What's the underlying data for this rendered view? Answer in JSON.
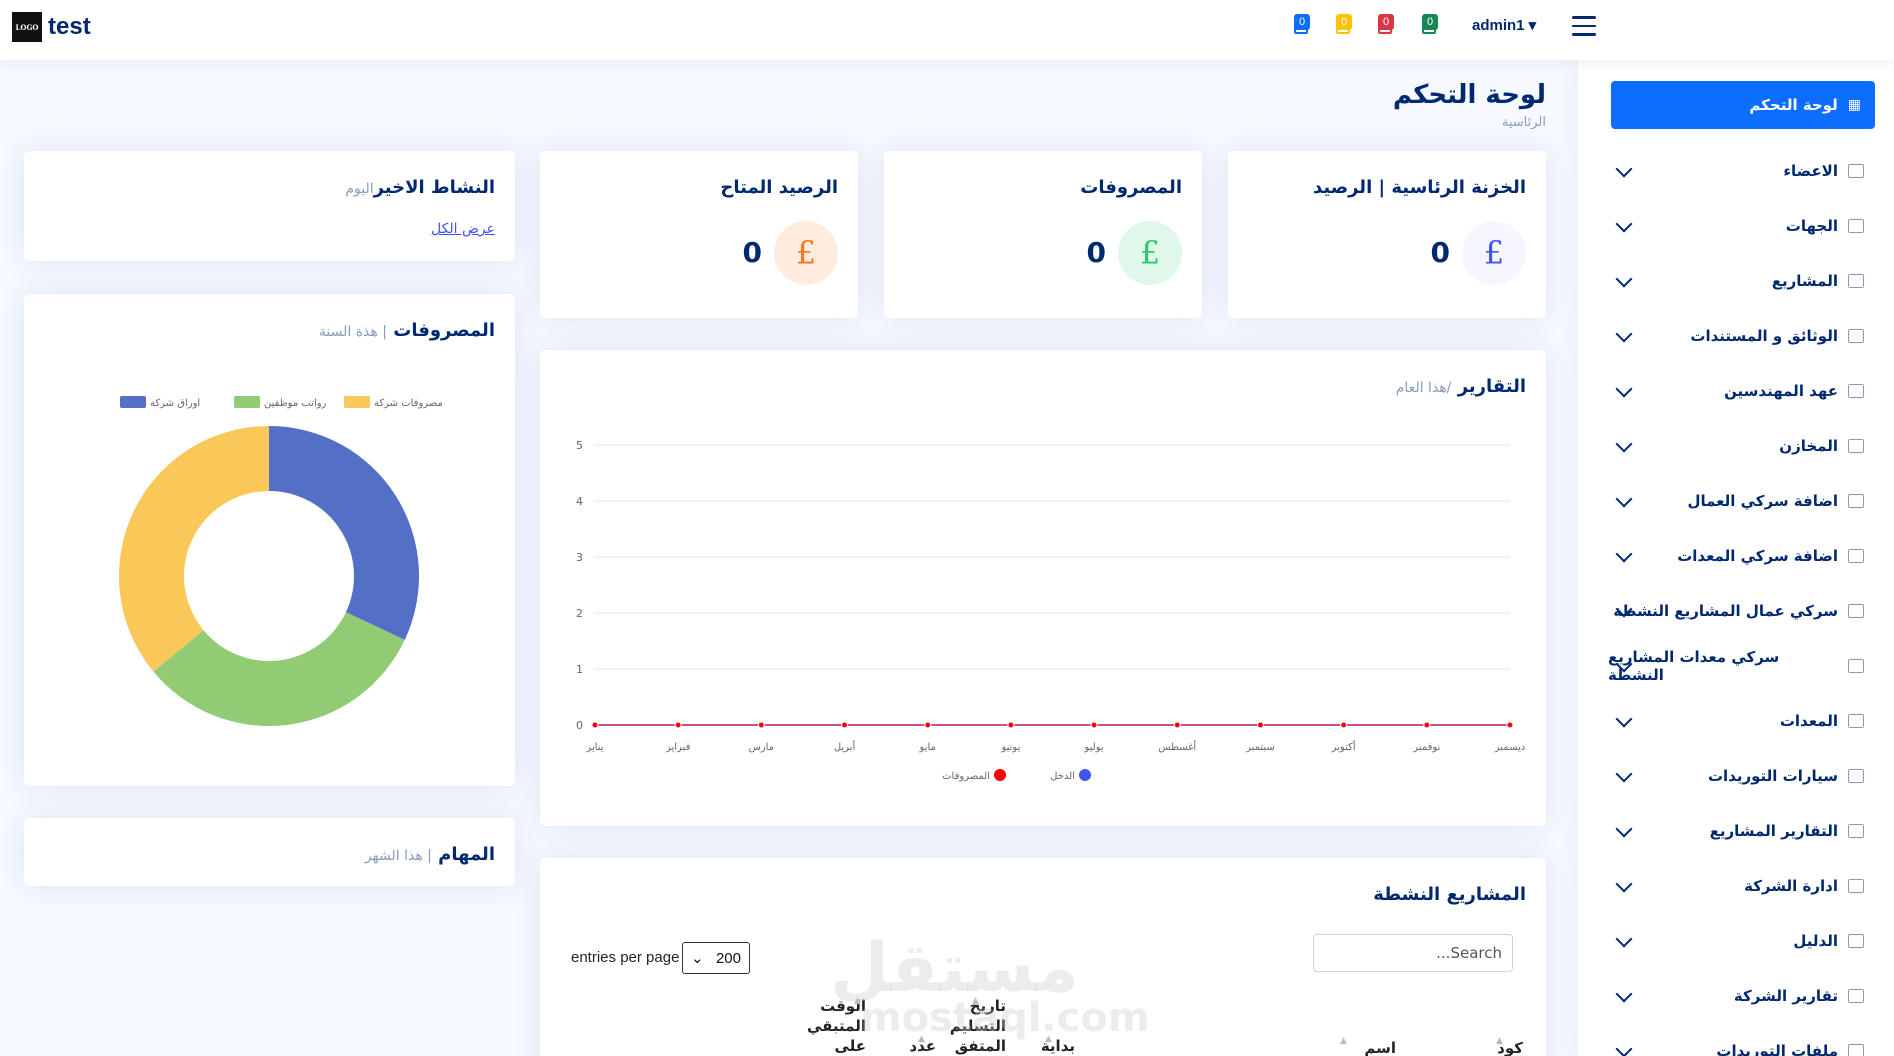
{
  "app": {
    "logo_text": "LOGO",
    "name": "test"
  },
  "header": {
    "notifications": [
      {
        "count": "0",
        "color": "#0d6efd"
      },
      {
        "count": "0",
        "color": "#ffc107"
      },
      {
        "count": "0",
        "color": "#dc3545"
      },
      {
        "count": "0",
        "color": "#198754"
      }
    ],
    "user": "admin1 ▾"
  },
  "sidebar": {
    "active": "لوحة التحكم",
    "items": [
      "الاعضاء",
      "الجهات",
      "المشاريع",
      "الوثائق و المستندات",
      "عهد المهندسين",
      "المخازن",
      "اضافة سركي العمال",
      "اضافة سركي المعدات",
      "سركي عمال المشاريع النشطة",
      "سركي معدات المشاريع النشطة",
      "المعدات",
      "سيارات التوريدات",
      "التقارير المشاريع",
      "ادارة الشركة",
      "الدليل",
      "تقارير الشركة",
      "ملفات التوريدات"
    ]
  },
  "page": {
    "title": "لوحة التحكم",
    "breadcrumb": "الرئاسية"
  },
  "stats": [
    {
      "title": "الخزنة الرئاسية | الرصيد",
      "value": "0",
      "symbol": "£",
      "color": "#4154f1",
      "bg": "#f6f6fe"
    },
    {
      "title": "المصروفات",
      "value": "0",
      "symbol": "£",
      "color": "#2eca6a",
      "bg": "#e0f8e9"
    },
    {
      "title": "الرصيد المتاح",
      "value": "0",
      "symbol": "£",
      "color": "#ff771d",
      "bg": "#ffecdf"
    }
  ],
  "activity": {
    "title": "النشاط الاخير",
    "sub": "اليوم",
    "link": "عرض الكل"
  },
  "expenses_card": {
    "title": "المصروفات",
    "sub": "| هذة السنة"
  },
  "tasks_card": {
    "title": "المهام",
    "sub": "| هذا الشهر"
  },
  "reports_card": {
    "title": "التقارير",
    "sub": "/هذا العام"
  },
  "projects_card": {
    "title": "المشاريع النشطة",
    "search_placeholder": "Search...",
    "entries_value": "200",
    "entries_label": "entries per page",
    "columns": [
      "كود",
      "اسم",
      "بداية",
      "تاريخ التسليم المتفق",
      "عدد",
      "الوقت المتبقي على"
    ]
  },
  "watermark": {
    "line1": "مستقل",
    "line2": "mostaql.com"
  },
  "chart_data": [
    {
      "type": "pie",
      "categories": [
        "مصروفات شركة",
        "رواتب موظفين",
        "اوراق شركة"
      ],
      "values": [
        36,
        32,
        32
      ],
      "colors": [
        "#fac858",
        "#91cc75",
        "#5470c6"
      ],
      "legend": "top"
    },
    {
      "type": "line",
      "categories": [
        "يناير",
        "فبراير",
        "مارس",
        "أبريل",
        "مايو",
        "يونيو",
        "يوليو",
        "أغسطس",
        "سبتمبر",
        "أكتوبر",
        "نوفمبر",
        "ديسمبر"
      ],
      "series": [
        {
          "name": "الدخل",
          "values": [
            0,
            0,
            0,
            0,
            0,
            0,
            0,
            0,
            0,
            0,
            0,
            0
          ],
          "color": "#4154f1"
        },
        {
          "name": "المصروفات",
          "values": [
            0,
            0,
            0,
            0,
            0,
            0,
            0,
            0,
            0,
            0,
            0,
            0
          ],
          "color": "#ff0000"
        }
      ],
      "ylim": [
        0,
        5
      ],
      "yticks": [
        "0",
        "1",
        "2",
        "3",
        "4",
        "5"
      ],
      "grid": true,
      "legend": "bottom"
    }
  ]
}
